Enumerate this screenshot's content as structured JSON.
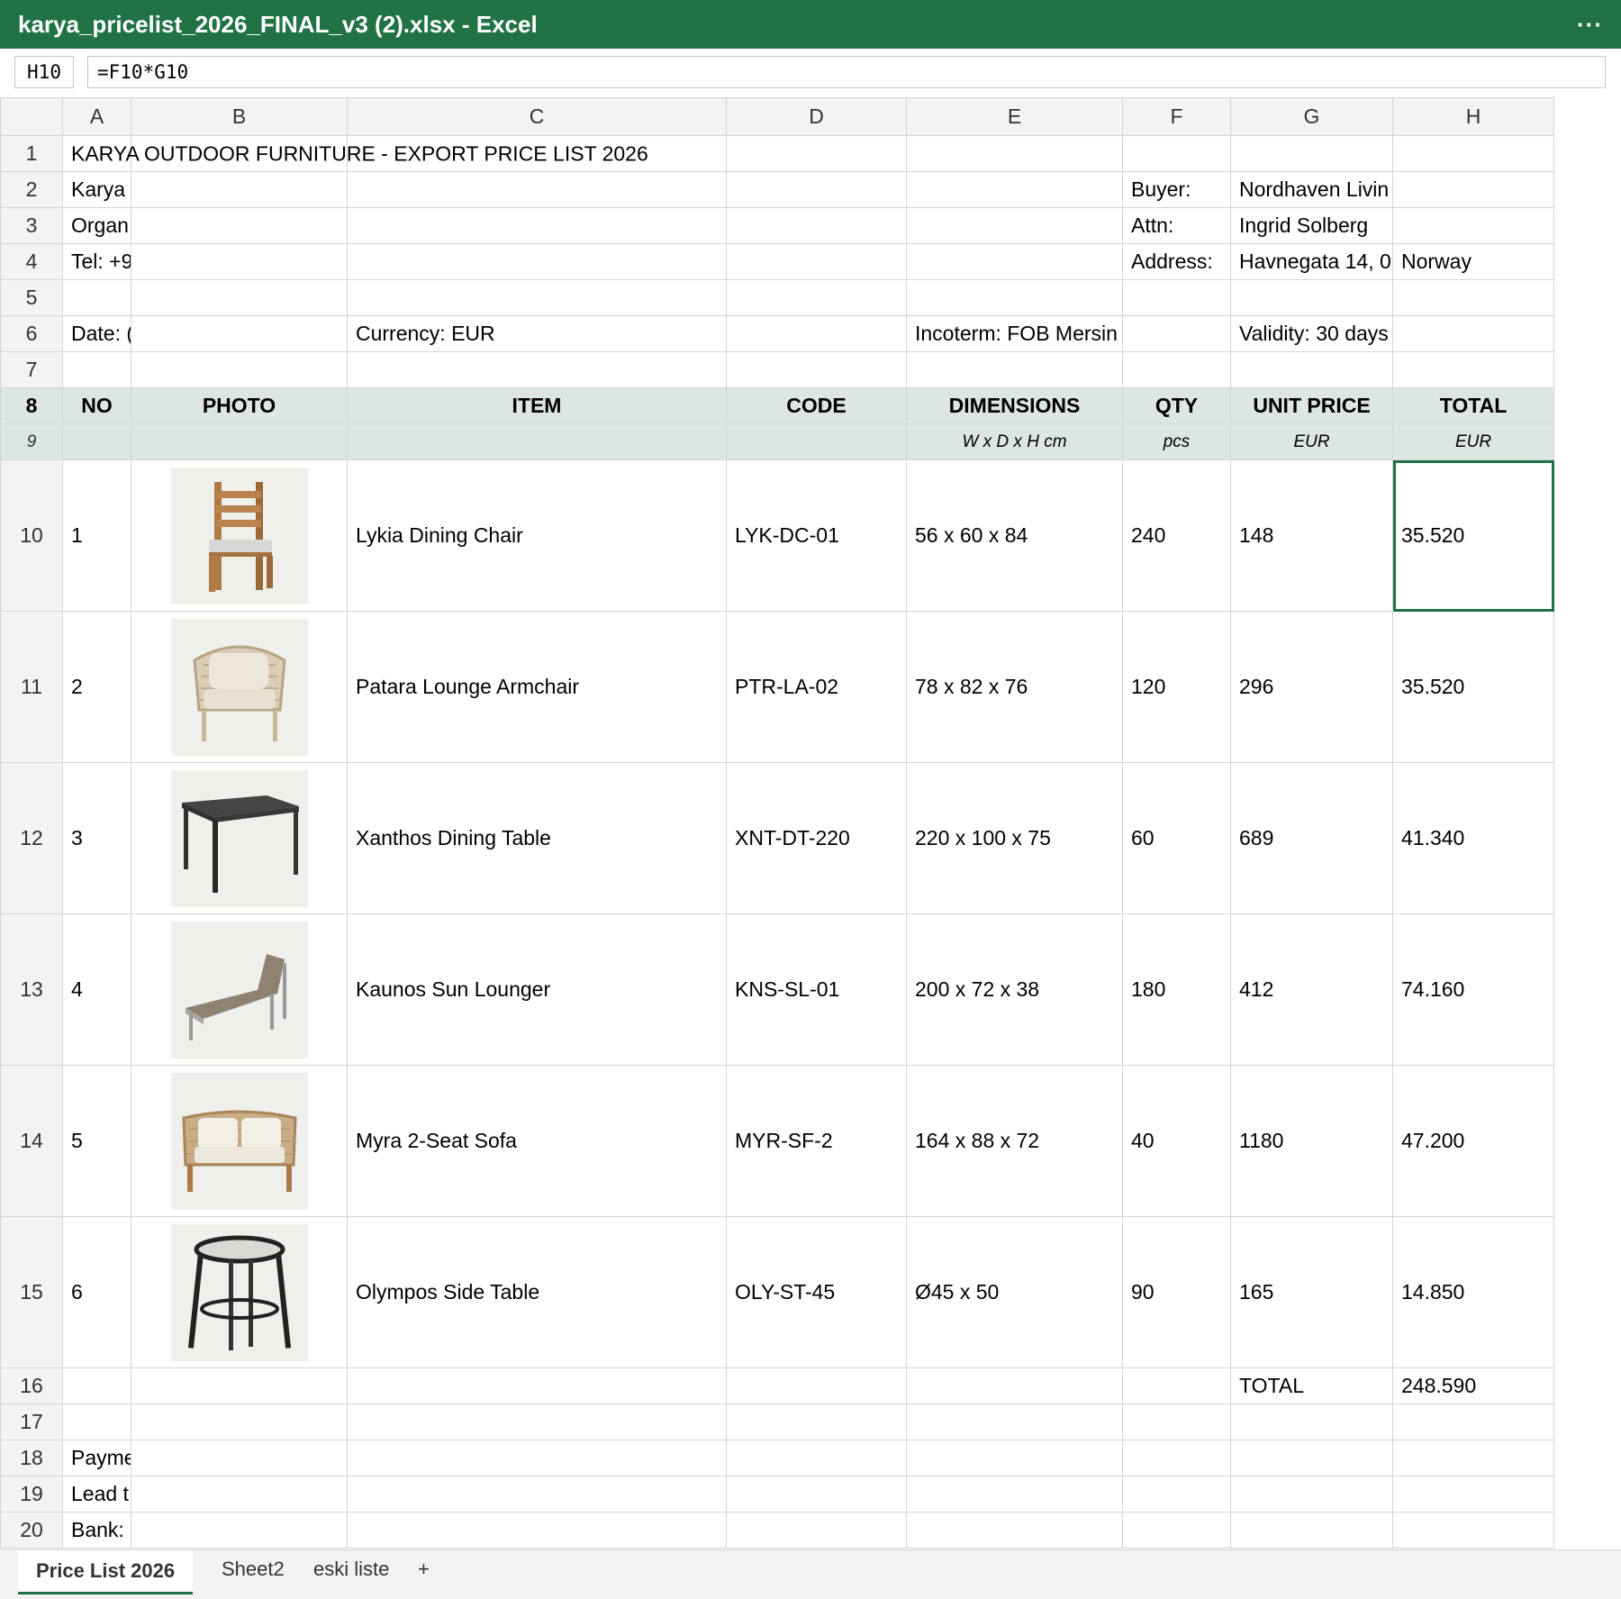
{
  "window": {
    "title": "karya_pricelist_2026_FINAL_v3 (2).xlsx - Excel",
    "more": "···"
  },
  "formula_bar": {
    "cell_ref": "H10",
    "formula": "=F10*G10"
  },
  "columns": [
    "A",
    "B",
    "C",
    "D",
    "E",
    "F",
    "G",
    "H"
  ],
  "rows": {
    "r1": {
      "title": "KARYA OUTDOOR FURNITURE - EXPORT PRICE LIST 2026"
    },
    "r2": {
      "a": "Karya",
      "f": "Buyer:",
      "g": "Nordhaven Livin"
    },
    "r3": {
      "a": "Organ",
      "f": "Attn:",
      "g": "Ingrid Solberg"
    },
    "r4": {
      "a": "Tel: +9",
      "f": "Address:",
      "g": "Havnegata 14, 0",
      "h": "Norway"
    },
    "r6": {
      "a": "Date: (",
      "c": "Currency: EUR",
      "e": "Incoterm: FOB Mersin",
      "g": "Validity: 30 days"
    },
    "r16": {
      "g": "TOTAL",
      "h": "248.590"
    },
    "r18": {
      "a": "Payme"
    },
    "r19": {
      "a": "Lead t"
    },
    "r20": {
      "a": "Bank:"
    }
  },
  "header": {
    "no": "NO",
    "photo": "PHOTO",
    "item": "ITEM",
    "code": "CODE",
    "dimensions": "DIMENSIONS",
    "qty": "QTY",
    "unit_price": "UNIT PRICE",
    "total": "TOTAL"
  },
  "subheader": {
    "dimensions": "W x D x H cm",
    "qty": "pcs",
    "unit_price": "EUR",
    "total": "EUR"
  },
  "items": [
    {
      "no": "1",
      "photo": "wooden-dining-chair-icon",
      "item": "Lykia Dining Chair",
      "code": "LYK-DC-01",
      "dimensions": "56 x 60 x 84",
      "qty": "240",
      "unit_price": "148",
      "total": "35.520"
    },
    {
      "no": "2",
      "photo": "rope-lounge-armchair-icon",
      "item": "Patara Lounge Armchair",
      "code": "PTR-LA-02",
      "dimensions": "78 x 82 x 76",
      "qty": "120",
      "unit_price": "296",
      "total": "35.520"
    },
    {
      "no": "3",
      "photo": "dining-table-icon",
      "item": "Xanthos Dining Table",
      "code": "XNT-DT-220",
      "dimensions": "220 x 100 x 75",
      "qty": "60",
      "unit_price": "689",
      "total": "41.340"
    },
    {
      "no": "4",
      "photo": "sun-lounger-icon",
      "item": "Kaunos Sun Lounger",
      "code": "KNS-SL-01",
      "dimensions": "200 x 72 x 38",
      "qty": "180",
      "unit_price": "412",
      "total": "74.160"
    },
    {
      "no": "5",
      "photo": "two-seat-sofa-icon",
      "item": "Myra 2-Seat Sofa",
      "code": "MYR-SF-2",
      "dimensions": "164 x 88 x 72",
      "qty": "40",
      "unit_price": "1180",
      "total": "47.200"
    },
    {
      "no": "6",
      "photo": "mosaic-side-table-icon",
      "item": "Olympos Side Table",
      "code": "OLY-ST-45",
      "dimensions": "Ø45 x 50",
      "qty": "90",
      "unit_price": "165",
      "total": "14.850"
    }
  ],
  "sheets": [
    {
      "label": "Price List 2026",
      "active": true
    },
    {
      "label": "Sheet2",
      "active": false
    },
    {
      "label": "eski liste",
      "active": false
    }
  ],
  "add_sheet": "+",
  "colors": {
    "accent": "#217346",
    "header_fill": "#dde7e2",
    "grid_line": "#d4d4d4"
  }
}
